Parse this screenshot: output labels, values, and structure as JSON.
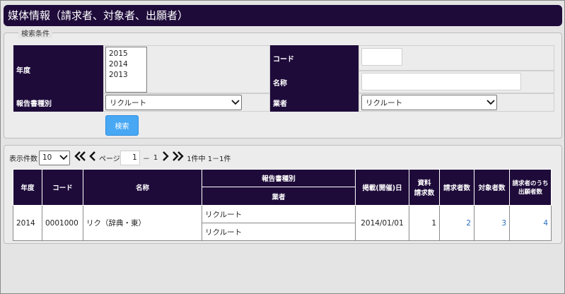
{
  "page_title": "媒体情報（請求者、対象者、出願者）",
  "search": {
    "legend": "検索条件",
    "year_label": "年度",
    "year_options": [
      "2015",
      "2014",
      "2013"
    ],
    "code_label": "コード",
    "code_value": "",
    "name_label": "名称",
    "name_value": "",
    "report_type_label": "報告書種別",
    "report_type_value": "リクルート",
    "vendor_label": "業者",
    "vendor_value": "リクルート",
    "search_button": "検索"
  },
  "pager": {
    "per_page_label": "表示件数",
    "per_page_value": "10",
    "first_icon": "double-left-chevron",
    "prev_icon": "left-chevron",
    "page_label": "ページ",
    "page_value": "1",
    "page_sep": "－",
    "page_total": "1",
    "next_icon": "right-chevron",
    "last_icon": "double-right-chevron",
    "summary": "1件中 1－1件"
  },
  "table": {
    "headers": {
      "year": "年度",
      "code": "コード",
      "name": "名称",
      "report_type": "報告書種別",
      "vendor": "業者",
      "publish_date": "掲載(開催)日",
      "doc_requests_1": "資料",
      "doc_requests_2": "請求数",
      "requesters": "請求者数",
      "targets": "対象者数",
      "applicants_1": "請求者のうち",
      "applicants_2": "出願者数"
    },
    "rows": [
      {
        "year": "2014",
        "code": "0001000",
        "name": "リク（辞典・東）",
        "report_type": "リクルート",
        "vendor": "リクルート",
        "publish_date": "2014/01/01",
        "doc_requests": "1",
        "requesters": "2",
        "targets": "3",
        "applicants": "4"
      }
    ]
  },
  "colors": {
    "header_bg": "#1e0b3a",
    "button_bg": "#49a8f3",
    "link": "#2a6fbf"
  }
}
